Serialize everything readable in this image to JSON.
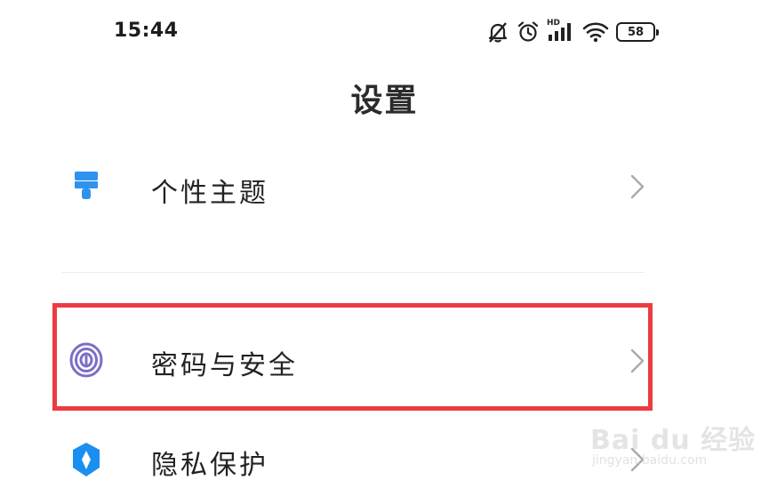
{
  "status_bar": {
    "time": "15:44",
    "battery_level": "58",
    "network_badge": "HD",
    "icons": [
      "mute-bell-icon",
      "alarm-icon",
      "signal-icon",
      "wifi-icon",
      "battery-icon"
    ]
  },
  "header": {
    "title": "设置"
  },
  "settings": {
    "items": [
      {
        "label": "个性主题",
        "icon": "paint-brush-icon"
      },
      {
        "label": "密码与安全",
        "icon": "fingerprint-icon"
      },
      {
        "label": "隐私保护",
        "icon": "privacy-shield-icon"
      }
    ]
  },
  "annotation": {
    "highlight_color": "#ec3b41"
  },
  "watermark": {
    "main": "Bai du 经验",
    "sub": "jingyan.baidu.com"
  }
}
